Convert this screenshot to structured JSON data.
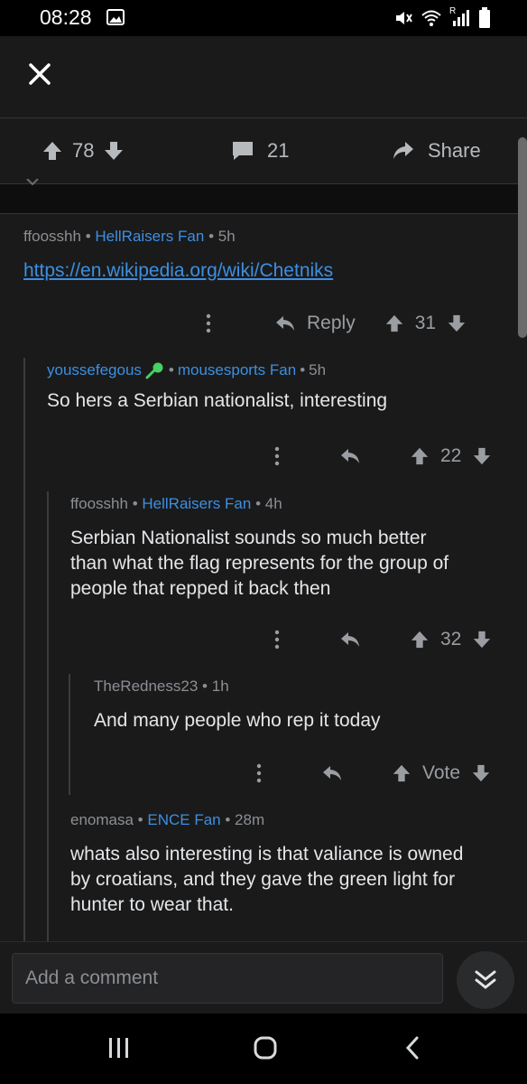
{
  "status_bar": {
    "time": "08:28",
    "icons": [
      "image-icon",
      "mute-icon",
      "wifi-icon",
      "signal-icon",
      "battery-icon"
    ],
    "signal_label": "R"
  },
  "post_actions": {
    "score": "78",
    "comments": "21",
    "share_label": "Share"
  },
  "comments": [
    {
      "user": "ffoosshh",
      "flair": "HellRaisers Fan",
      "age": "5h",
      "link": "https://en.wikipedia.org/wiki/Chetniks",
      "reply_label": "Reply",
      "score": "31"
    },
    {
      "user": "youssefegous",
      "flair": "mousesports Fan",
      "age": "5h",
      "text": "So hers a Serbian nationalist, interesting",
      "score": "22"
    },
    {
      "user": "ffoosshh",
      "flair": "HellRaisers Fan",
      "age": "4h",
      "text_lines": [
        "Serbian Nationalist sounds so much better",
        "than what the flag represents for the group of",
        "people that repped it back then"
      ],
      "score": "32"
    },
    {
      "user": "TheRedness23",
      "age": "1h",
      "text": "And many people who rep it today",
      "vote_label": "Vote"
    },
    {
      "user": "enomasa",
      "flair": "ENCE Fan",
      "age": "28m",
      "text_lines": [
        "whats also interesting is that valiance is owned",
        "by croatians, and they gave the green light for",
        "hunter to wear that."
      ]
    }
  ],
  "separator": "•",
  "comment_input": {
    "placeholder": "Add a comment"
  },
  "colors": {
    "background": "#1a1a1b",
    "accent_blue": "#3d8fe0",
    "text_primary": "#e4e6e8",
    "text_muted": "#8b8f93"
  }
}
